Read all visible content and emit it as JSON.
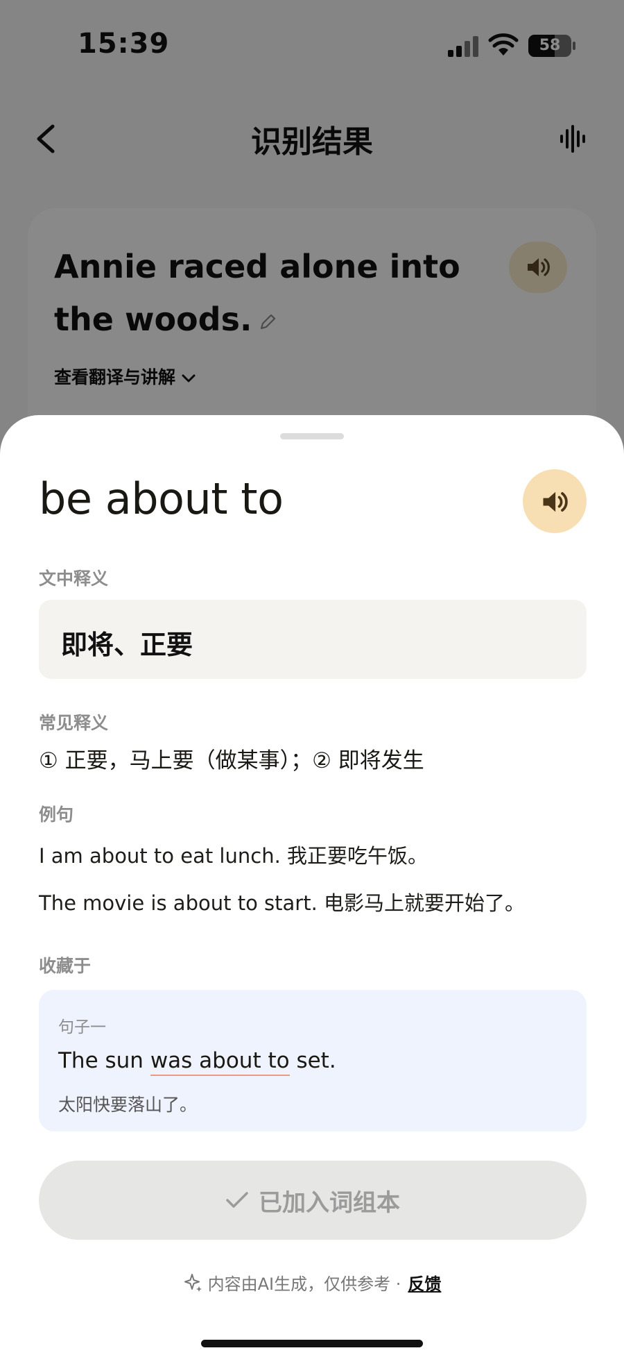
{
  "status_bar": {
    "time": "15:39",
    "battery_level": "58"
  },
  "nav": {
    "title": "识别结果"
  },
  "sentence_card": {
    "sentence": "Annie raced alone into the woods.",
    "translate_toggle": "查看翻译与讲解"
  },
  "sheet": {
    "word": "be about to",
    "context_label": "文中释义",
    "context_meaning": "即将、正要",
    "common_label": "常见释义",
    "common_meaning": "① 正要，马上要（做某事）；② 即将发生",
    "examples_label": "例句",
    "examples": [
      "I am about to eat lunch. 我正要吃午饭。",
      "The movie is about to start. 电影马上就要开始了。"
    ],
    "collected_label": "收藏于",
    "collected": {
      "name": "句子一",
      "sentence_before": "The sun ",
      "sentence_highlight": "was about to",
      "sentence_after": " set.",
      "translation": "太阳快要落山了。"
    },
    "added_button": "已加入词组本",
    "footer_note": "内容由AI生成，仅供参考 ·",
    "feedback": "反馈"
  },
  "colors": {
    "sheet_bg": "#ffffff",
    "speaker_bg": "#f8deb3",
    "speaker_icon": "#4a3519",
    "meaning_bg": "#f4f3ef",
    "collect_bg": "#eef3fe",
    "highlight_underline": "#e79b7f",
    "button_bg": "#e6e6e5"
  },
  "icons": [
    "back-icon",
    "voiceprint-icon",
    "speaker-icon",
    "pencil-icon",
    "chevron-down-icon",
    "check-icon",
    "sparkle-icon"
  ]
}
